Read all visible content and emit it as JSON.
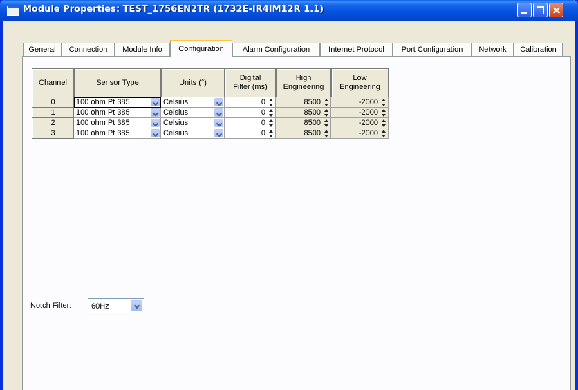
{
  "window": {
    "title": "Module Properties: TEST_1756EN2TR (1732E-IR4IM12R 1.1)"
  },
  "tabs": [
    {
      "label": "General",
      "active": false
    },
    {
      "label": "Connection",
      "active": false
    },
    {
      "label": "Module Info",
      "active": false
    },
    {
      "label": "Configuration",
      "active": true
    },
    {
      "label": "Alarm Configuration",
      "active": false
    },
    {
      "label": "Internet Protocol",
      "active": false
    },
    {
      "label": "Port Configuration",
      "active": false
    },
    {
      "label": "Network",
      "active": false
    },
    {
      "label": "Calibration",
      "active": false
    }
  ],
  "grid": {
    "headers": {
      "channel": "Channel",
      "sensor_type": "Sensor Type",
      "units": "Units (°)",
      "digital_filter_1": "Digital",
      "digital_filter_2": "Filter (ms)",
      "high_eng_1": "High",
      "high_eng_2": "Engineering",
      "low_eng_1": "Low",
      "low_eng_2": "Engineering"
    },
    "rows": [
      {
        "channel": "0",
        "sensor_type": "100 ohm Pt 385",
        "units": "Celsius",
        "digital_filter": "0",
        "high_engineering": "8500",
        "low_engineering": "-2000"
      },
      {
        "channel": "1",
        "sensor_type": "100 ohm Pt 385",
        "units": "Celsius",
        "digital_filter": "0",
        "high_engineering": "8500",
        "low_engineering": "-2000"
      },
      {
        "channel": "2",
        "sensor_type": "100 ohm Pt 385",
        "units": "Celsius",
        "digital_filter": "0",
        "high_engineering": "8500",
        "low_engineering": "-2000"
      },
      {
        "channel": "3",
        "sensor_type": "100 ohm Pt 385",
        "units": "Celsius",
        "digital_filter": "0",
        "high_engineering": "8500",
        "low_engineering": "-2000"
      }
    ]
  },
  "notch_filter": {
    "label": "Notch Filter:",
    "value": "60Hz"
  }
}
